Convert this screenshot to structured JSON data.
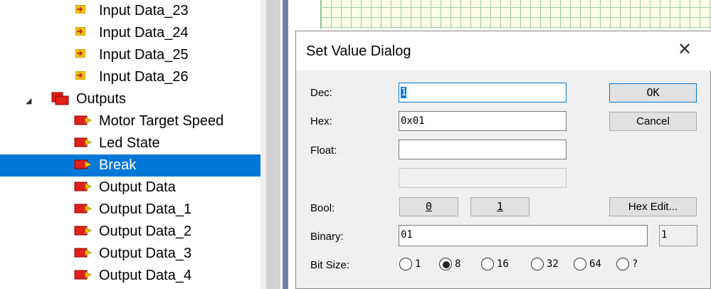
{
  "tree": {
    "input_items": [
      "Input Data_23",
      "Input Data_24",
      "Input Data_25",
      "Input Data_26"
    ],
    "outputs_label": "Outputs",
    "output_items": [
      "Motor Target Speed",
      "Led State",
      "Break",
      "Output Data",
      "Output Data_1",
      "Output Data_2",
      "Output Data_3",
      "Output Data_4"
    ],
    "selected_item": "Break"
  },
  "dialog": {
    "title": "Set Value Dialog",
    "close_glyph": "✕",
    "dec_label": "Dec:",
    "dec_value": "1",
    "hex_label": "Hex:",
    "hex_value": "0x01",
    "float_label": "Float:",
    "float_value": "",
    "bool_label": "Bool:",
    "bool_0": "0",
    "bool_1": "1",
    "binary_label": "Binary:",
    "binary_value": "01",
    "binary_count": "1",
    "bitsize_label": "Bit Size:",
    "bitsize_options": [
      "1",
      "8",
      "16",
      "32",
      "64",
      "?"
    ],
    "bitsize_selected": "8",
    "ok_label": "OK",
    "cancel_label": "Cancel",
    "hex_edit_label": "Hex Edit..."
  },
  "colors": {
    "selection": "#0078d7",
    "input_icon": "#f2c200",
    "output_icon": "#e0201b"
  },
  "icons": {
    "input": "input-variable-icon",
    "output": "output-variable-icon",
    "folder": "outputs-folder-icon"
  }
}
